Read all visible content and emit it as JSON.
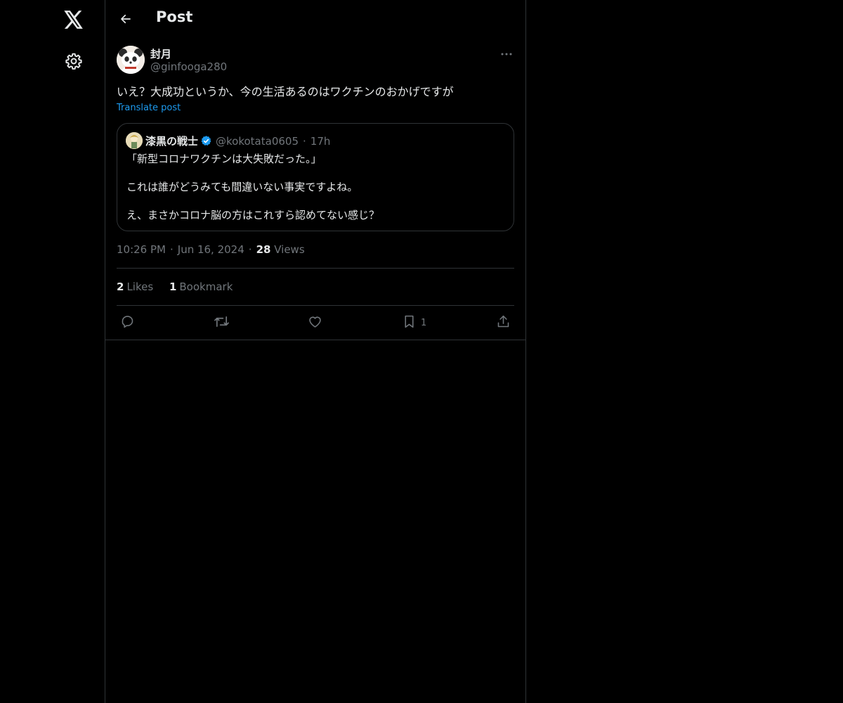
{
  "header": {
    "title": "Post"
  },
  "nav": {
    "logo_icon": "x-logo-icon",
    "settings_icon": "gear-icon"
  },
  "post": {
    "author_name": "封月",
    "author_handle": "@ginfooga280",
    "text": "いえ？大成功というか、今の生活あるのはワクチンのおかげですが",
    "translate_label": "Translate post",
    "time": "10:26 PM",
    "date": "Jun 16, 2024",
    "views_count": "28",
    "views_label": "Views",
    "likes_count": "2",
    "likes_label": "Likes",
    "bookmarks_count": "1",
    "bookmarks_label": "Bookmark"
  },
  "quote": {
    "author_name": "漆黒の戦士",
    "author_handle": "@kokotata0605",
    "time_ago": "17h",
    "line1": "「新型コロナワクチンは大失敗だった。」",
    "line2": "これは誰がどうみても間違いない事実ですよね。",
    "line3": "え、まさかコロナ脳の方はこれすら認めてない感じ？"
  },
  "actions": {
    "bookmark_count": "1"
  },
  "colors": {
    "background": "#000000",
    "text": "#e7e9ea",
    "secondary": "#71767b",
    "accent": "#1d9bf0",
    "border": "#2f3336"
  }
}
